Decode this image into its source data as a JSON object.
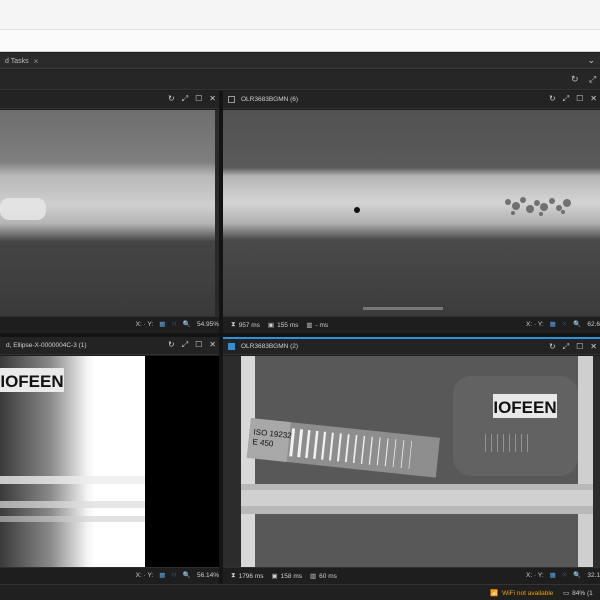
{
  "tabbar": {
    "tab_label": "d Tasks",
    "close": "×",
    "chevron": "⌄"
  },
  "panels": {
    "top_left": {
      "title": "",
      "footer": {
        "xy": "X: · Y:",
        "zoom": "54.95%"
      }
    },
    "top_right": {
      "title": "OLR3683BGMN (6)",
      "footer": {
        "time1": "957 ms",
        "time2": "155 ms",
        "time3": "- ms",
        "xy": "X: · Y:",
        "zoom": "62.6"
      }
    },
    "bottom_left": {
      "title": "d, Ellipse-X-0000004C-3 (1)",
      "image_text": "IOFEEN",
      "footer": {
        "xy": "X: · Y:",
        "zoom": "56.14%"
      }
    },
    "bottom_right": {
      "title": "OLR3683BGMN (2)",
      "image_text": "IOFEEN",
      "iqi_text_1": "ISO 19232",
      "iqi_text_2": "E 450",
      "footer": {
        "time1": "1796 ms",
        "time2": "158 ms",
        "time3": "60 ms",
        "xy": "X: · Y:",
        "zoom": "32.1"
      }
    }
  },
  "status": {
    "wifi": "WiFi not available",
    "battery": "84% (1"
  },
  "icons": [
    "refresh-icon",
    "fit-icon",
    "maximize-icon",
    "close-icon",
    "hourglass-icon",
    "image-icon",
    "bar-chart-icon",
    "grid-icon",
    "dots-grid-icon",
    "zoom-icon",
    "wifi-icon",
    "battery-icon"
  ]
}
